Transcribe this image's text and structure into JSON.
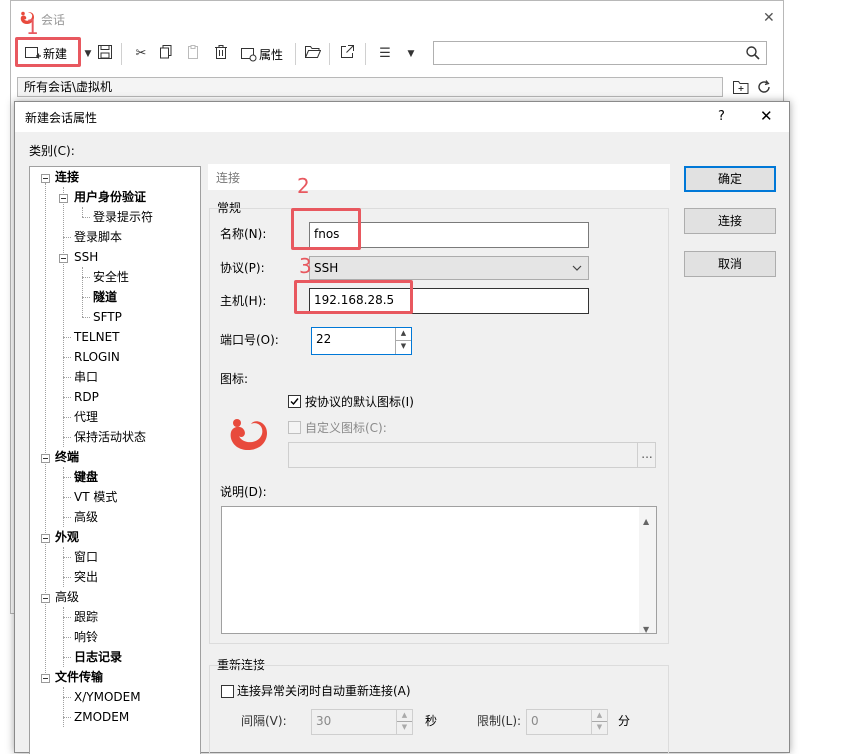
{
  "background_window": {
    "title": "会话",
    "toolbar": {
      "new_label": "新建",
      "properties_label": "属性"
    },
    "search": {
      "value": ""
    },
    "path": "所有会话\\虚拟机"
  },
  "dialog": {
    "title": "新建会话属性",
    "help_glyph": "?",
    "close_glyph": "✕",
    "category_label": "类别(C):",
    "tree": {
      "connection": "连接",
      "user_auth": "用户身份验证",
      "login_prompt": "登录提示符",
      "login_script": "登录脚本",
      "ssh": "SSH",
      "security": "安全性",
      "tunnel": "隧道",
      "sftp": "SFTP",
      "telnet": "TELNET",
      "rlogin": "RLOGIN",
      "serial": "串口",
      "rdp": "RDP",
      "proxy": "代理",
      "keepalive": "保持活动状态",
      "terminal": "终端",
      "keyboard": "键盘",
      "vt_mode": "VT 模式",
      "term_advanced": "高级",
      "appearance": "外观",
      "window": "窗口",
      "highlight": "突出",
      "advanced": "高级",
      "tracking": "跟踪",
      "bell": "响铃",
      "logging": "日志记录",
      "file_transfer": "文件传输",
      "xymodem": "X/YMODEM",
      "zmodem": "ZMODEM"
    },
    "section_header": "连接",
    "general_group": "常规",
    "name_label": "名称(N):",
    "name_value": "fnos",
    "protocol_label": "协议(P):",
    "protocol_value": "SSH",
    "host_label": "主机(H):",
    "host_value": "192.168.28.5",
    "port_label": "端口号(O):",
    "port_value": "22",
    "icon_label": "图标:",
    "default_icon_label": "按协议的默认图标(I)",
    "default_icon_checked": true,
    "custom_icon_label": "自定义图标(C):",
    "custom_icon_checked": false,
    "browse_glyph": "...",
    "description_label": "说明(D):",
    "reconnect_group": "重新连接",
    "reconnect_label": "连接异常关闭时自动重新连接(A)",
    "reconnect_checked": false,
    "interval_label": "间隔(V):",
    "interval_value": "30",
    "interval_unit": "秒",
    "limit_label": "限制(L):",
    "limit_value": "0",
    "limit_unit": "分",
    "buttons": {
      "ok": "确定",
      "connect": "连接",
      "cancel": "取消"
    }
  },
  "annotations": {
    "step1": "1",
    "step2": "2",
    "step3": "3",
    "color": "#e8585f"
  },
  "colors": {
    "accent": "#0078d7",
    "logo": "#e84a3c"
  }
}
